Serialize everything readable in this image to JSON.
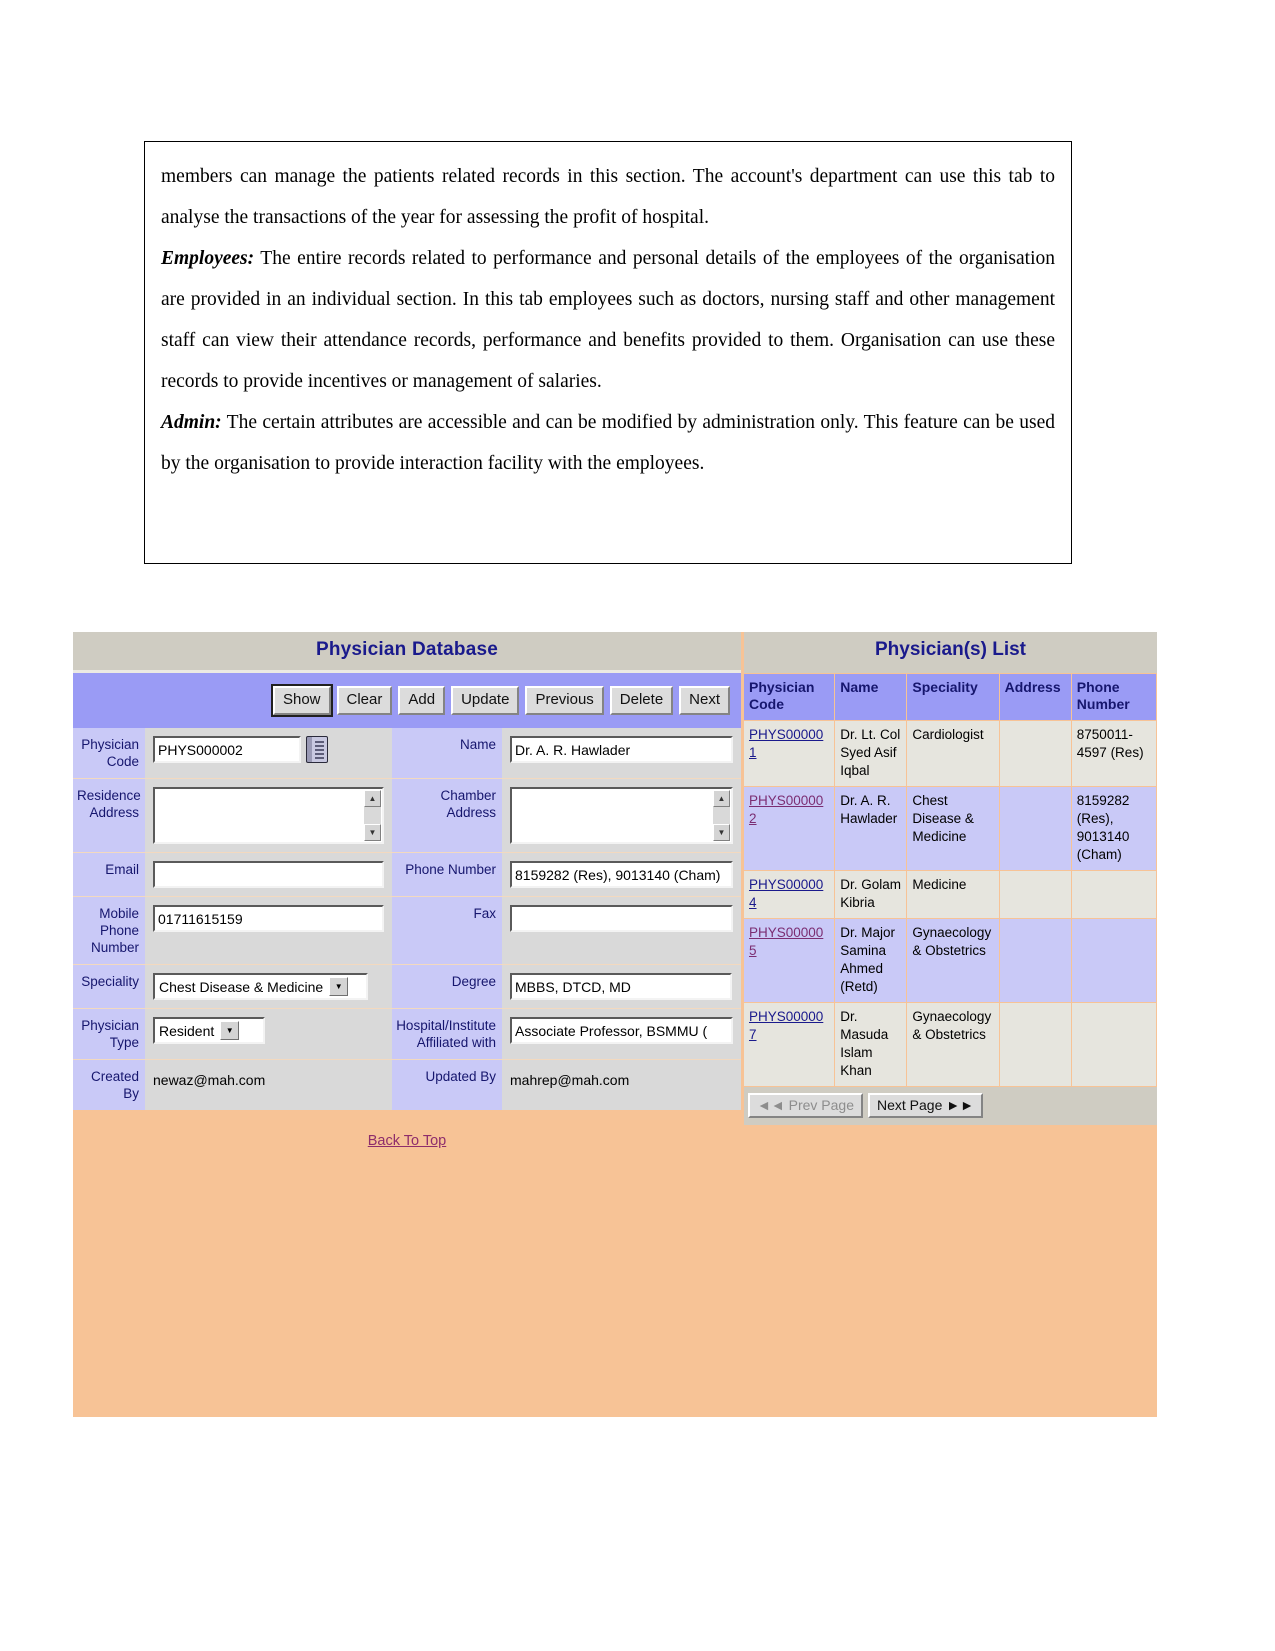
{
  "document": {
    "paragraphs": [
      {
        "lead": "",
        "text": "members can manage the patients related records in this section. The account's department can use this tab to analyse the transactions of the year for assessing the profit of hospital."
      },
      {
        "lead": "Employees:",
        "text": " The entire records related to performance and personal details of the employees of the organisation are provided in an individual section. In this tab employees such as doctors, nursing staff and other management staff can view their attendance records, performance and benefits provided to them. Organisation can use these records to provide incentives or management of salaries."
      },
      {
        "lead": "Admin:",
        "text": " The certain attributes are accessible and can be modified by administration only. This feature can be used by the organisation to provide interaction facility with the employees."
      }
    ]
  },
  "app": {
    "left_panel": {
      "title": "Physician Database",
      "toolbar": {
        "buttons": [
          {
            "label": "Show",
            "focused": true
          },
          {
            "label": "Clear",
            "focused": false
          },
          {
            "label": "Add",
            "focused": false
          },
          {
            "label": "Update",
            "focused": false
          },
          {
            "label": "Previous",
            "focused": false
          },
          {
            "label": "Delete",
            "focused": false
          },
          {
            "label": "Next",
            "focused": false
          }
        ]
      },
      "fields": {
        "physician_code_label": "Physician Code",
        "physician_code_value": "PHYS000002",
        "physician_code_icon": "notepad-icon",
        "name_label": "Name",
        "name_value": "Dr. A. R. Hawlader",
        "residence_address_label": "Residence Address",
        "residence_address_value": "",
        "chamber_address_label": "Chamber Address",
        "chamber_address_value": "",
        "email_label": "Email",
        "email_value": "",
        "phone_number_label": "Phone Number",
        "phone_number_value": "8159282 (Res), 9013140 (Cham)",
        "mobile_phone_label": "Mobile Phone Number",
        "mobile_phone_value": "01711615159",
        "fax_label": "Fax",
        "fax_value": "",
        "speciality_label": "Speciality",
        "speciality_value": "Chest Disease & Medicine",
        "degree_label": "Degree",
        "degree_value": "MBBS, DTCD, MD",
        "physician_type_label": "Physician Type",
        "physician_type_value": "Resident",
        "hospital_label": "Hospital/Institute Affiliated with",
        "hospital_value": "Associate Professor, BSMMU (",
        "created_by_label": "Created By",
        "created_by_value": "newaz@mah.com",
        "updated_by_label": "Updated By",
        "updated_by_value": "mahrep@mah.com"
      },
      "back_to_top": "Back To Top"
    },
    "right_panel": {
      "title": "Physician(s) List",
      "columns": [
        "Physician Code",
        "Name",
        "Speciality",
        "Address",
        "Phone Number"
      ],
      "rows": [
        {
          "code": "PHYS000001",
          "name": "Dr. Lt. Col Syed Asif Iqbal",
          "speciality": "Cardiologist",
          "address": "",
          "phone": "8750011-4597 (Res)"
        },
        {
          "code": "PHYS000002",
          "name": "Dr. A. R. Hawlader",
          "speciality": "Chest Disease & Medicine",
          "address": "",
          "phone": "8159282 (Res), 9013140 (Cham)"
        },
        {
          "code": "PHYS000004",
          "name": "Dr. Golam Kibria",
          "speciality": "Medicine",
          "address": "",
          "phone": ""
        },
        {
          "code": "PHYS000005",
          "name": "Dr. Major Samina Ahmed (Retd)",
          "speciality": "Gynaecology & Obstetrics",
          "address": "",
          "phone": ""
        },
        {
          "code": "PHYS000007",
          "name": "Dr. Masuda Islam Khan",
          "speciality": "Gynaecology & Obstetrics",
          "address": "",
          "phone": ""
        }
      ],
      "pager": {
        "prev_label": "◄◄ Prev Page",
        "next_label": "Next Page ►►"
      }
    },
    "colors": {
      "panel_background": "#f7c396",
      "toolbar_blue": "#9a9bf5",
      "title_bar": "#cfccc2",
      "title_text": "#1a1a8c",
      "label_background": "#c9c9f7",
      "field_background": "#d9d9d9",
      "link": "#7b2d72"
    }
  }
}
